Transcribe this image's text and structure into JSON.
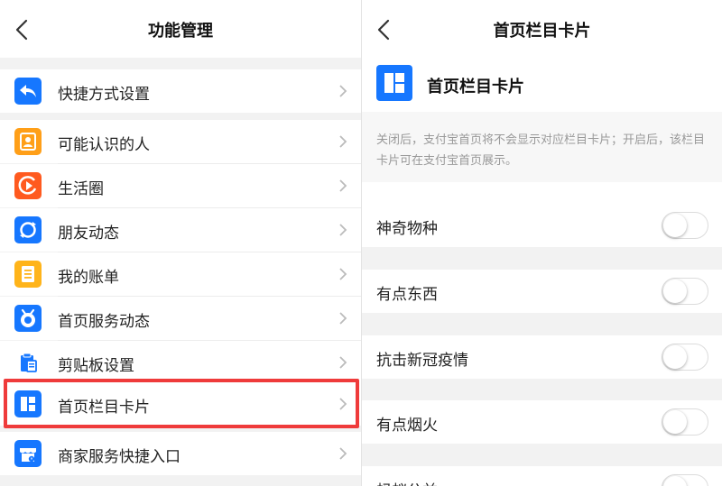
{
  "left": {
    "title": "功能管理",
    "items": [
      {
        "label": "快捷方式设置",
        "icon": "reply-icon",
        "color": "#1677ff"
      },
      {
        "label": "可能认识的人",
        "icon": "contact-card-icon",
        "color": "#ff9f18"
      },
      {
        "label": "生活圈",
        "icon": "play-circle-icon",
        "color": "#ff5a1f"
      },
      {
        "label": "朋友动态",
        "icon": "circle-arrows-icon",
        "color": "#1677ff"
      },
      {
        "label": "我的账单",
        "icon": "bill-list-icon",
        "color": "#ffb41a"
      },
      {
        "label": "首页服务动态",
        "icon": "service-bell-icon",
        "color": "#1677ff"
      },
      {
        "label": "剪贴板设置",
        "icon": "clipboard-icon",
        "color": "#1677ff"
      },
      {
        "label": "首页栏目卡片",
        "icon": "layout-card-icon",
        "color": "#1677ff"
      },
      {
        "label": "商家服务快捷入口",
        "icon": "storefront-icon",
        "color": "#1677ff"
      }
    ]
  },
  "right": {
    "title": "首页栏目卡片",
    "header_label": "首页栏目卡片",
    "description": "关闭后，支付宝首页将不会显示对应栏目卡片；开启后，该栏目卡片可在支付宝首页展示。",
    "toggles": [
      {
        "label": "神奇物种",
        "on": false
      },
      {
        "label": "有点东西",
        "on": false
      },
      {
        "label": "抗击新冠疫情",
        "on": false
      },
      {
        "label": "有点烟火",
        "on": false
      },
      {
        "label": "蚂蚁公益",
        "on": false
      }
    ]
  },
  "colors": {
    "accent": "#1677ff",
    "highlight": "#ef3b3b"
  }
}
